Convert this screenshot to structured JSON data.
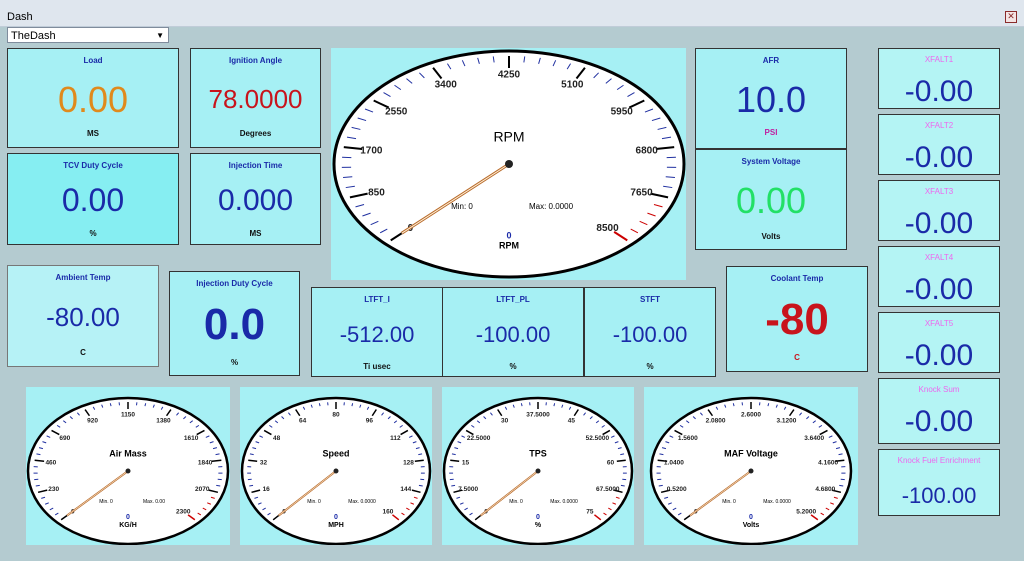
{
  "window": {
    "title": "Dash"
  },
  "dash_selector": {
    "value": "TheDash"
  },
  "panels": {
    "load": {
      "label": "Load",
      "value": "0.00",
      "unit": "MS"
    },
    "ignition": {
      "label": "Ignition Angle",
      "value": "78.0000",
      "unit": "Degrees"
    },
    "tcv": {
      "label": "TCV Duty Cycle",
      "value": "0.00",
      "unit": "%"
    },
    "injtime": {
      "label": "Injection Time",
      "value": "0.000",
      "unit": "MS"
    },
    "afr": {
      "label": "AFR",
      "value": "10.0",
      "unit": "PSI"
    },
    "sysvolt": {
      "label": "System Voltage",
      "value": "0.00",
      "unit": "Volts"
    },
    "ambient": {
      "label": "Ambient Temp",
      "value": "-80.00",
      "unit": "C"
    },
    "injduty": {
      "label": "Injection Duty Cycle",
      "value": "0.0",
      "unit": "%"
    },
    "ltft_i": {
      "label": "LTFT_I",
      "value": "-512.00",
      "unit": "Ti usec"
    },
    "ltft_pl": {
      "label": "LTFT_PL",
      "value": "-100.00",
      "unit": "%"
    },
    "stft": {
      "label": "STFT",
      "value": "-100.00",
      "unit": "%"
    },
    "coolant": {
      "label": "Coolant Temp",
      "value": "-80",
      "unit": "C"
    }
  },
  "right_panels": [
    {
      "label": "XFALT1",
      "value": "-0.00"
    },
    {
      "label": "XFALT2",
      "value": "-0.00"
    },
    {
      "label": "XFALT3",
      "value": "-0.00"
    },
    {
      "label": "XFALT4",
      "value": "-0.00"
    },
    {
      "label": "XFALT5",
      "value": "-0.00"
    },
    {
      "label": "Knock Sum",
      "value": "-0.00"
    },
    {
      "label": "Knock Fuel Enrichment",
      "value": "-100.00"
    }
  ],
  "gauges": {
    "rpm": {
      "title": "RPM",
      "ticks": [
        "0",
        "850",
        "1700",
        "2550",
        "3400",
        "4250",
        "5100",
        "5950",
        "6800",
        "7650",
        "8500"
      ],
      "min_text": "Min: 0",
      "max_text": "Max: 0.0000",
      "reading": "0",
      "unit": "RPM",
      "value": 0,
      "max": 8500
    },
    "airmass": {
      "title": "Air Mass",
      "ticks": [
        "0",
        "230",
        "460",
        "690",
        "920",
        "1150",
        "1380",
        "1610",
        "1840",
        "2070",
        "2300"
      ],
      "min_text": "Min. 0",
      "max_text": "Max. 0.00",
      "reading": "0",
      "unit": "KG/H",
      "value": 0,
      "max": 2300
    },
    "speed": {
      "title": "Speed",
      "ticks": [
        "0",
        "16",
        "32",
        "48",
        "64",
        "80",
        "96",
        "112",
        "128",
        "144",
        "160"
      ],
      "min_text": "Min. 0",
      "max_text": "Max. 0.0000",
      "reading": "0",
      "unit": "MPH",
      "value": 0,
      "max": 160
    },
    "tps": {
      "title": "TPS",
      "ticks": [
        "0",
        "7.5000",
        "15",
        "22.5000",
        "30",
        "37.5000",
        "45",
        "52.5000",
        "60",
        "67.5000",
        "75"
      ],
      "min_text": "Min. 0",
      "max_text": "Max. 0.0000",
      "reading": "0",
      "unit": "%",
      "value": 0,
      "max": 75
    },
    "maf": {
      "title": "MAF Voltage",
      "ticks": [
        "0",
        "0.5200",
        "1.0400",
        "1.5600",
        "2.0800",
        "2.6000",
        "3.1200",
        "3.6400",
        "4.1600",
        "4.6800",
        "5.2000"
      ],
      "min_text": "Min. 0",
      "max_text": "Max. 0.0000",
      "reading": "0",
      "unit": "Volts",
      "value": 0,
      "max": 5.2
    }
  },
  "colors": {
    "panel_bg": "#a6f0f4",
    "value_blue": "#1a2aa8",
    "value_orange": "#e08a1c",
    "value_red": "#c8141c",
    "value_green": "#22e066",
    "label_magenta": "#ee66ee"
  }
}
